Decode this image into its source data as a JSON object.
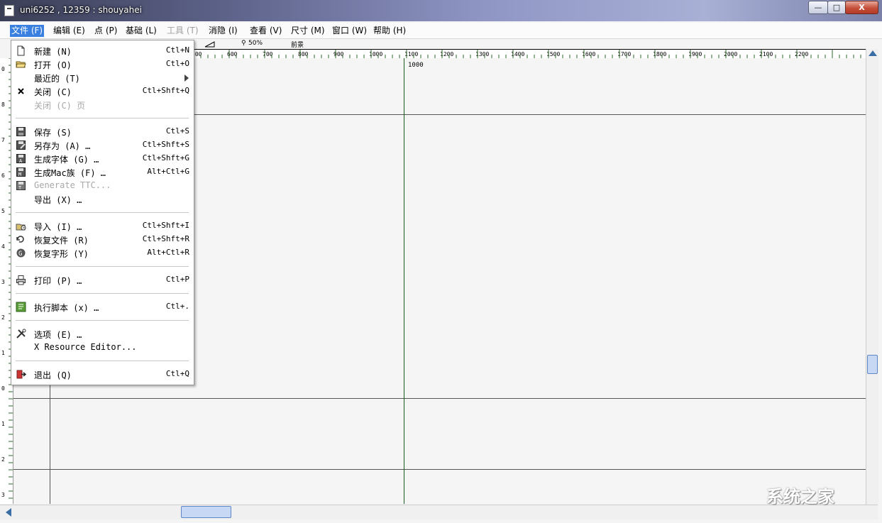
{
  "window": {
    "title": "uni6252 , 12359 : shouyahei",
    "buttons": {
      "minimize": "—",
      "maximize": "□",
      "close": "X"
    }
  },
  "menubar": [
    {
      "label": "文件 (F)",
      "state": "active"
    },
    {
      "label": "编辑 (E)",
      "state": "normal"
    },
    {
      "label": "点 (P)",
      "state": "normal"
    },
    {
      "label": "基础 (L)",
      "state": "normal"
    },
    {
      "label": "工具 (T)",
      "state": "disabled"
    },
    {
      "label": "消隐 (I)",
      "state": "normal"
    },
    {
      "label": "查看 (V)",
      "state": "normal"
    },
    {
      "label": "尺寸 (M)",
      "state": "normal"
    },
    {
      "label": "窗口 (W)",
      "state": "normal"
    },
    {
      "label": "帮助 (H)",
      "state": "normal"
    }
  ],
  "toolbar": {
    "zoom": "50%",
    "layer": "前景"
  },
  "ruler": {
    "top_labels": [
      "0",
      "500",
      "600",
      "700",
      "800",
      "900",
      "1000",
      "1100",
      "1200",
      "1300",
      "1400",
      "1500",
      "1600",
      "1700",
      "1800",
      "1900",
      "2000",
      "2100",
      "2200"
    ],
    "guide_label": "1000",
    "left_labels": [
      "0",
      "8",
      "7",
      "6",
      "5",
      "4",
      "3",
      "2",
      "1",
      "0",
      "1",
      "2",
      "3"
    ]
  },
  "file_menu": {
    "items": [
      {
        "type": "item",
        "icon": "new-file-icon",
        "label": "新建 (N)",
        "shortcut": "Ctl+N",
        "enabled": true
      },
      {
        "type": "item",
        "icon": "open-folder-icon",
        "label": "打开 (O)",
        "shortcut": "Ctl+O",
        "enabled": true
      },
      {
        "type": "submenu",
        "icon": "",
        "label": "最近的 (T)",
        "shortcut": "",
        "enabled": true
      },
      {
        "type": "item",
        "icon": "close-x-icon",
        "label": "关闭 (C)",
        "shortcut": "Ctl+Shft+Q",
        "enabled": true
      },
      {
        "type": "item",
        "icon": "",
        "label": "关闭 (C) 页",
        "shortcut": "",
        "enabled": false
      },
      {
        "type": "separator"
      },
      {
        "type": "item",
        "icon": "save-icon",
        "label": "保存 (S)",
        "shortcut": "Ctl+S",
        "enabled": true
      },
      {
        "type": "item",
        "icon": "save-as-icon",
        "label": "另存为 (A) …",
        "shortcut": "Ctl+Shft+S",
        "enabled": true
      },
      {
        "type": "item",
        "icon": "generate-font-icon",
        "label": "生成字体 (G) …",
        "shortcut": "Ctl+Shft+G",
        "enabled": true
      },
      {
        "type": "item",
        "icon": "generate-mac-icon",
        "label": "生成Mac族 (F) …",
        "shortcut": "Alt+Ctl+G",
        "enabled": true
      },
      {
        "type": "item",
        "icon": "generate-ttc-icon",
        "label": "Generate TTC...",
        "shortcut": "",
        "enabled": false
      },
      {
        "type": "item",
        "icon": "",
        "label": "导出 (X) …",
        "shortcut": "",
        "enabled": true
      },
      {
        "type": "separator"
      },
      {
        "type": "item",
        "icon": "import-icon",
        "label": "导入 (I) …",
        "shortcut": "Ctl+Shft+I",
        "enabled": true
      },
      {
        "type": "item",
        "icon": "revert-file-icon",
        "label": "恢复文件 (R)",
        "shortcut": "Ctl+Shft+R",
        "enabled": true
      },
      {
        "type": "item",
        "icon": "revert-glyph-icon",
        "label": "恢复字形 (Y)",
        "shortcut": "Alt+Ctl+R",
        "enabled": true
      },
      {
        "type": "separator"
      },
      {
        "type": "item",
        "icon": "print-icon",
        "label": "打印 (P) …",
        "shortcut": "Ctl+P",
        "enabled": true
      },
      {
        "type": "separator"
      },
      {
        "type": "item",
        "icon": "script-icon",
        "label": "执行脚本 (x) …",
        "shortcut": "Ctl+.",
        "enabled": true
      },
      {
        "type": "separator"
      },
      {
        "type": "item",
        "icon": "options-icon",
        "label": "选项 (E) …",
        "shortcut": "",
        "enabled": true
      },
      {
        "type": "item",
        "icon": "",
        "label": "X Resource Editor...",
        "shortcut": "",
        "enabled": true
      },
      {
        "type": "separator"
      },
      {
        "type": "item",
        "icon": "quit-icon",
        "label": "退出 (Q)",
        "shortcut": "Ctl+Q",
        "enabled": true
      }
    ]
  },
  "watermark": "系统之家"
}
